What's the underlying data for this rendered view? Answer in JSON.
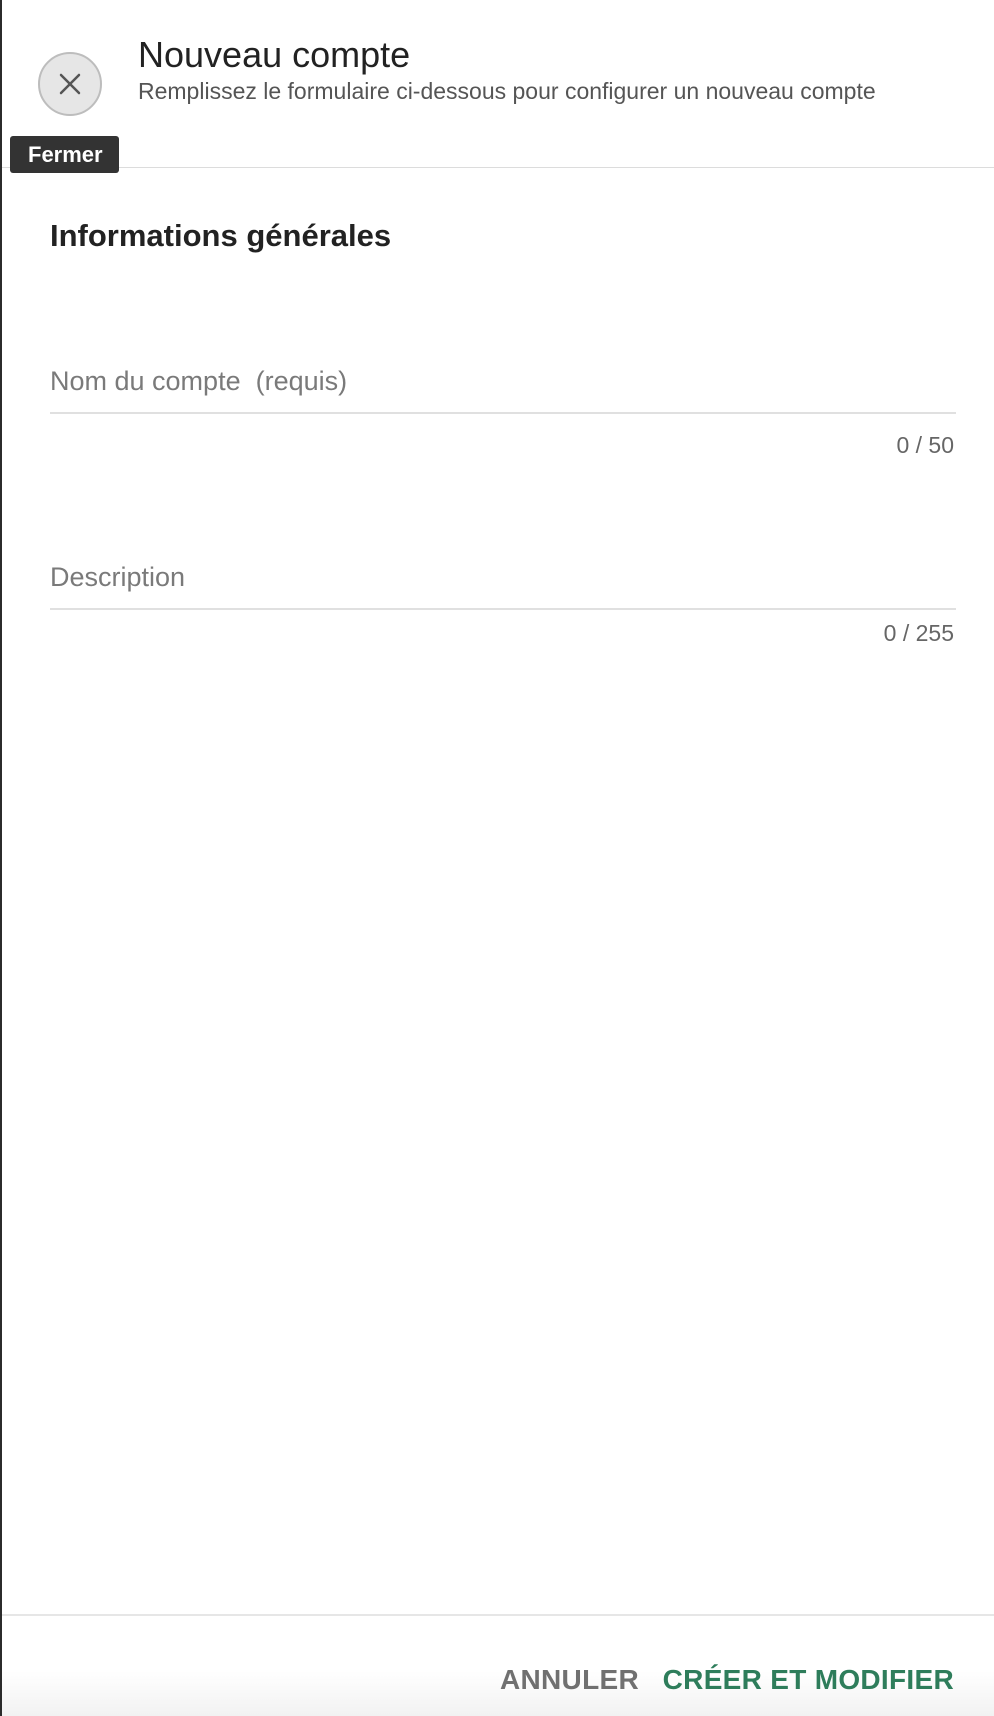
{
  "header": {
    "title": "Nouveau compte",
    "subtitle": "Remplissez le formulaire ci-dessous pour configurer un nouveau compte",
    "close_tooltip": "Fermer",
    "close_icon": "close-icon"
  },
  "form": {
    "section_title": "Informations générales",
    "account_name": {
      "placeholder": "Nom du compte  (requis)",
      "value": "",
      "counter": "0 / 50"
    },
    "description": {
      "placeholder": "Description",
      "value": "",
      "counter": "0 / 255"
    }
  },
  "footer": {
    "cancel_label": "ANNULER",
    "create_label": "CRÉER ET MODIFIER"
  },
  "colors": {
    "accent": "#2e7d5b",
    "tooltip_bg": "#333333"
  }
}
